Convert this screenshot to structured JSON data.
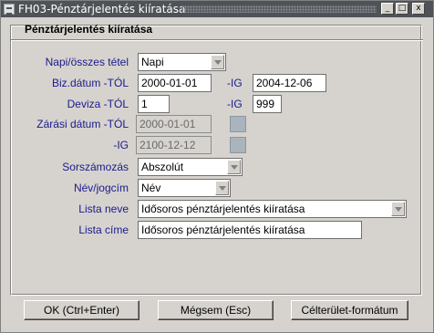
{
  "window": {
    "title": "FH03-Pénztárjelentés kiíratása",
    "minimize_glyph": "_",
    "maximize_glyph": "□",
    "close_glyph": "x"
  },
  "form": {
    "section_title": "Pénztárjelentés kiíratása",
    "napi_label": "Napi/összes tétel",
    "napi_value": "Napi",
    "biz_datum_label": "Biz.dátum -TÓL",
    "biz_datum_tol": "2000-01-01",
    "ig_label": "-IG",
    "biz_datum_ig": "2004-12-06",
    "deviza_label": "Deviza -TÓL",
    "deviza_tol": "1",
    "deviza_ig_label": "-IG",
    "deviza_ig": "999",
    "zarasi_label": "Zárási dátum -TÓL",
    "zarasi_tol": "2000-01-01",
    "zarasi_ig_label": "-IG",
    "zarasi_ig": "2100-12-12",
    "sorszam_label": "Sorszámozás",
    "sorszam_value": "Abszolút",
    "nev_label": "Név/jogcím",
    "nev_value": "Név",
    "lista_neve_label": "Lista neve",
    "lista_neve_value": "Idősoros pénztárjelentés kiíratása",
    "lista_cime_label": "Lista címe",
    "lista_cime_value": "Idősoros pénztárjelentés kiíratása"
  },
  "buttons": {
    "ok": "OK (Ctrl+Enter)",
    "cancel": "Mégsem (Esc)",
    "format": "Célterület-formátum"
  },
  "colors": {
    "titlebar": "#4f5358",
    "label_text": "#1a1a8c",
    "dialog_bg": "#d6d3ce"
  }
}
